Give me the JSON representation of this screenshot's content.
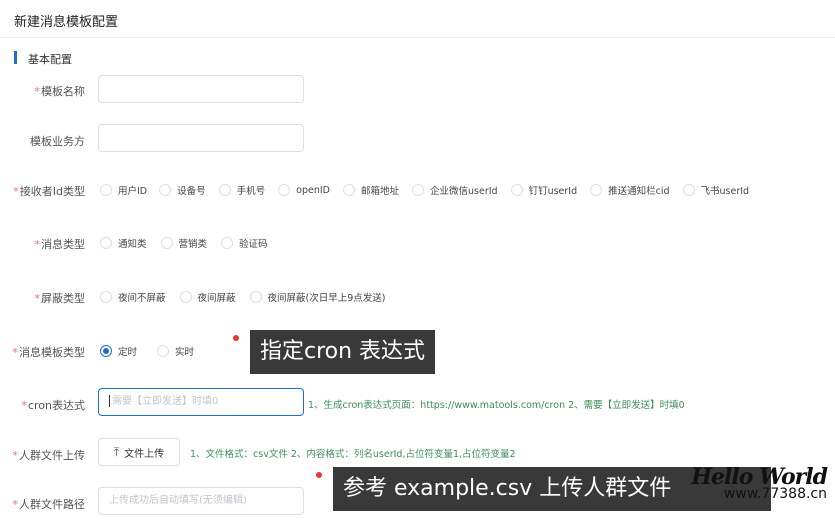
{
  "header": {
    "title": "新建消息模板配置"
  },
  "section": {
    "title": "基本配置"
  },
  "fields": {
    "template_name": {
      "label": "模板名称",
      "required": "*",
      "value": ""
    },
    "template_owner": {
      "label": "模板业务方",
      "value": ""
    },
    "receiver_type": {
      "label": "接收者Id类型",
      "required": "*",
      "options": [
        "用户ID",
        "设备号",
        "手机号",
        "openID",
        "邮箱地址",
        "企业微信userId",
        "钉钉userId",
        "推送通知栏cid",
        "飞书userId"
      ]
    },
    "message_type": {
      "label": "消息类型",
      "required": "*",
      "options": [
        "通知类",
        "营销类",
        "验证码"
      ]
    },
    "shield_type": {
      "label": "屏蔽类型",
      "required": "*",
      "options": [
        "夜间不屏蔽",
        "夜间屏蔽",
        "夜间屏蔽(次日早上9点发送)"
      ]
    },
    "template_type": {
      "label": "消息模板类型",
      "required": "*",
      "options": [
        "定时",
        "实时"
      ],
      "selected": "定时"
    },
    "cron": {
      "label": "cron表达式",
      "required": "*",
      "placeholder": "需要【立即发送】时填0",
      "hint": "1、生成cron表达式页面：https://www.matools.com/cron 2、需要【立即发送】时填0"
    },
    "crowd_upload": {
      "label": "人群文件上传",
      "required": "*",
      "button": "文件上传",
      "hint": "1、文件格式：csv文件 2、内容格式：列名userId,占位符变量1,占位符变量2"
    },
    "crowd_path": {
      "label": "人群文件路径",
      "required": "*",
      "placeholder": "上传成功后自动填写(无须编辑)"
    }
  },
  "overlays": {
    "cron_tip": "指定cron 表达式",
    "csv_tip": "参考 example.csv 上传人群文件"
  },
  "watermark": {
    "line1": "Hello World",
    "line2": "www.77388.cn"
  },
  "colors": {
    "accent": "#1f6fd1",
    "required": "#f56c6c",
    "hint": "#3a8f5a"
  }
}
